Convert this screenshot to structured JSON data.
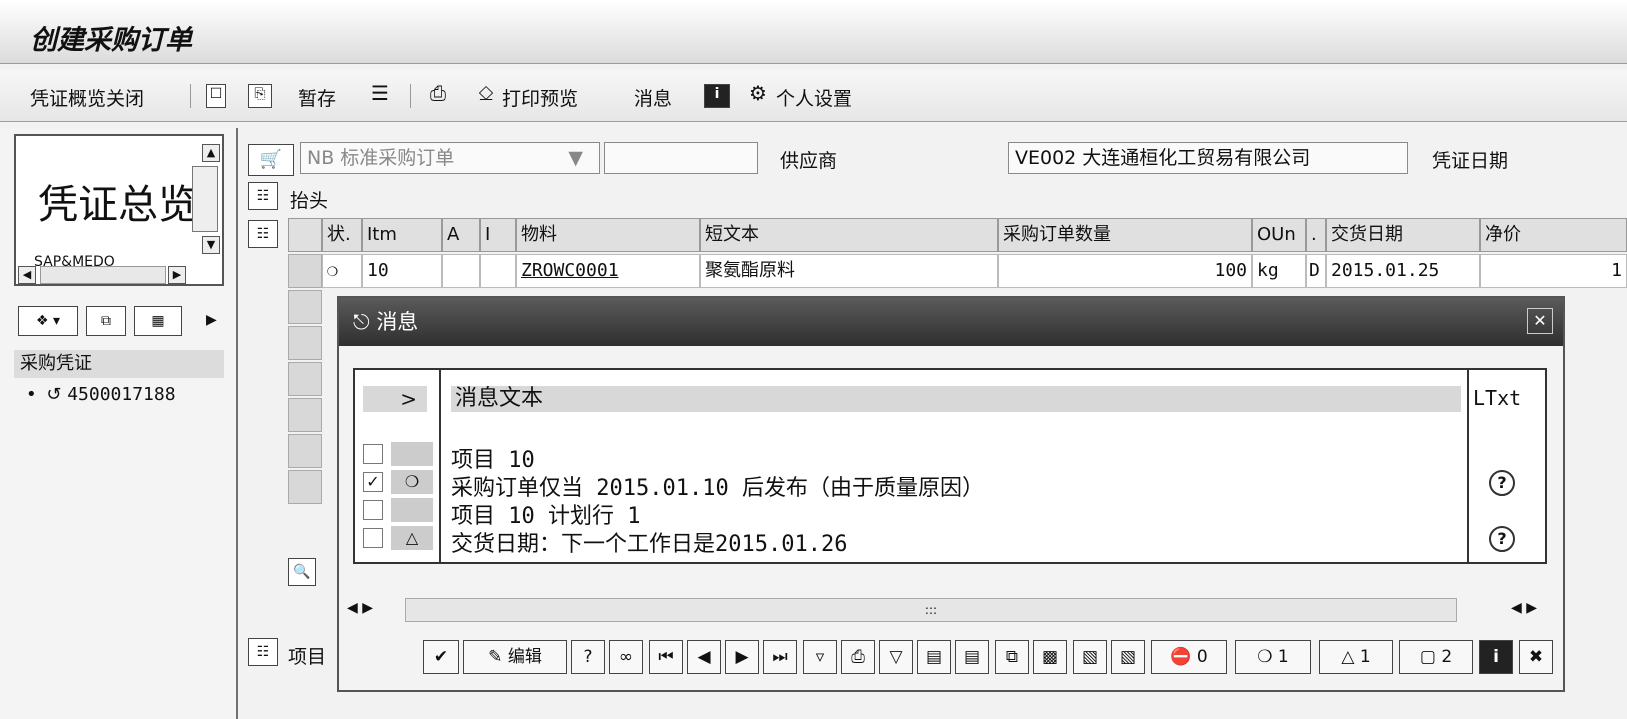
{
  "title": "创建采购订单",
  "toolbar": {
    "doc_overview_close": "凭证概览关闭",
    "hold": "暂存",
    "print_preview": "打印预览",
    "messages": "消息",
    "personal_settings": "个人设置"
  },
  "left": {
    "overview_title": "凭证总览",
    "overview_sub": "SAP&MEDO",
    "tree_header": "采购凭证",
    "tree_item": "4500017188"
  },
  "header": {
    "doc_type": "NB 标准采购订单",
    "vendor_label": "供应商",
    "vendor_value": "VE002 大连通桓化工贸易有限公司",
    "doc_date_label": "凭证日期",
    "header_label": "抬头"
  },
  "grid": {
    "columns": [
      "状.",
      "Itm",
      "A",
      "I",
      "物料",
      "短文本",
      "采购订单数量",
      "OUn",
      ".",
      "交货日期",
      "净价"
    ],
    "row": {
      "itm": "10",
      "material": "ZROWC0001",
      "short_text": "聚氨酯原料",
      "qty": "100",
      "oun": "kg",
      "d": "D",
      "delivery_date": "2015.01.25",
      "net_price": "1"
    },
    "item_label": "项目"
  },
  "dialog": {
    "title": "消息",
    "col_arrow": ">",
    "col_text": "消息文本",
    "col_ltxt": "LTxt",
    "messages": [
      {
        "text": "项目 10"
      },
      {
        "text": "采购订单仅当 2015.01.10 后发布（由于质量原因）"
      },
      {
        "text": "项目 10 计划行 1"
      },
      {
        "text": "交货日期：下一个工作日是2015.01.26"
      }
    ],
    "buttons": {
      "edit": "编辑",
      "stop_count": "0",
      "error_count": "1",
      "warning_count": "1",
      "info_count": "2"
    }
  }
}
